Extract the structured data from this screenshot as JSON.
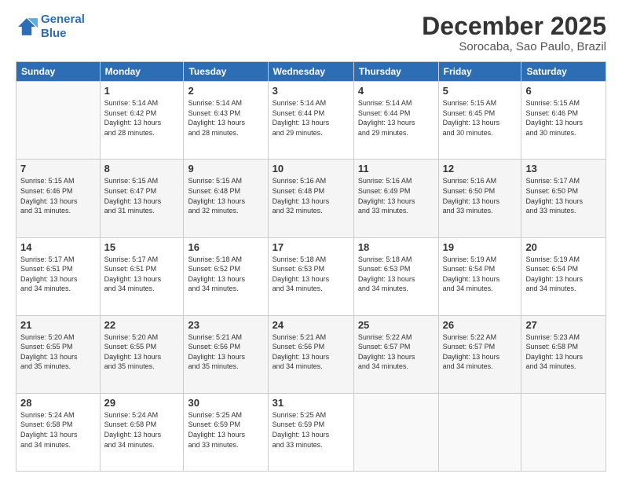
{
  "logo": {
    "line1": "General",
    "line2": "Blue"
  },
  "header": {
    "month": "December 2025",
    "location": "Sorocaba, Sao Paulo, Brazil"
  },
  "days_of_week": [
    "Sunday",
    "Monday",
    "Tuesday",
    "Wednesday",
    "Thursday",
    "Friday",
    "Saturday"
  ],
  "weeks": [
    [
      {
        "day": "",
        "info": ""
      },
      {
        "day": "1",
        "info": "Sunrise: 5:14 AM\nSunset: 6:42 PM\nDaylight: 13 hours\nand 28 minutes."
      },
      {
        "day": "2",
        "info": "Sunrise: 5:14 AM\nSunset: 6:43 PM\nDaylight: 13 hours\nand 28 minutes."
      },
      {
        "day": "3",
        "info": "Sunrise: 5:14 AM\nSunset: 6:44 PM\nDaylight: 13 hours\nand 29 minutes."
      },
      {
        "day": "4",
        "info": "Sunrise: 5:14 AM\nSunset: 6:44 PM\nDaylight: 13 hours\nand 29 minutes."
      },
      {
        "day": "5",
        "info": "Sunrise: 5:15 AM\nSunset: 6:45 PM\nDaylight: 13 hours\nand 30 minutes."
      },
      {
        "day": "6",
        "info": "Sunrise: 5:15 AM\nSunset: 6:46 PM\nDaylight: 13 hours\nand 30 minutes."
      }
    ],
    [
      {
        "day": "7",
        "info": "Sunrise: 5:15 AM\nSunset: 6:46 PM\nDaylight: 13 hours\nand 31 minutes."
      },
      {
        "day": "8",
        "info": "Sunrise: 5:15 AM\nSunset: 6:47 PM\nDaylight: 13 hours\nand 31 minutes."
      },
      {
        "day": "9",
        "info": "Sunrise: 5:15 AM\nSunset: 6:48 PM\nDaylight: 13 hours\nand 32 minutes."
      },
      {
        "day": "10",
        "info": "Sunrise: 5:16 AM\nSunset: 6:48 PM\nDaylight: 13 hours\nand 32 minutes."
      },
      {
        "day": "11",
        "info": "Sunrise: 5:16 AM\nSunset: 6:49 PM\nDaylight: 13 hours\nand 33 minutes."
      },
      {
        "day": "12",
        "info": "Sunrise: 5:16 AM\nSunset: 6:50 PM\nDaylight: 13 hours\nand 33 minutes."
      },
      {
        "day": "13",
        "info": "Sunrise: 5:17 AM\nSunset: 6:50 PM\nDaylight: 13 hours\nand 33 minutes."
      }
    ],
    [
      {
        "day": "14",
        "info": "Sunrise: 5:17 AM\nSunset: 6:51 PM\nDaylight: 13 hours\nand 34 minutes."
      },
      {
        "day": "15",
        "info": "Sunrise: 5:17 AM\nSunset: 6:51 PM\nDaylight: 13 hours\nand 34 minutes."
      },
      {
        "day": "16",
        "info": "Sunrise: 5:18 AM\nSunset: 6:52 PM\nDaylight: 13 hours\nand 34 minutes."
      },
      {
        "day": "17",
        "info": "Sunrise: 5:18 AM\nSunset: 6:53 PM\nDaylight: 13 hours\nand 34 minutes."
      },
      {
        "day": "18",
        "info": "Sunrise: 5:18 AM\nSunset: 6:53 PM\nDaylight: 13 hours\nand 34 minutes."
      },
      {
        "day": "19",
        "info": "Sunrise: 5:19 AM\nSunset: 6:54 PM\nDaylight: 13 hours\nand 34 minutes."
      },
      {
        "day": "20",
        "info": "Sunrise: 5:19 AM\nSunset: 6:54 PM\nDaylight: 13 hours\nand 34 minutes."
      }
    ],
    [
      {
        "day": "21",
        "info": "Sunrise: 5:20 AM\nSunset: 6:55 PM\nDaylight: 13 hours\nand 35 minutes."
      },
      {
        "day": "22",
        "info": "Sunrise: 5:20 AM\nSunset: 6:55 PM\nDaylight: 13 hours\nand 35 minutes."
      },
      {
        "day": "23",
        "info": "Sunrise: 5:21 AM\nSunset: 6:56 PM\nDaylight: 13 hours\nand 35 minutes."
      },
      {
        "day": "24",
        "info": "Sunrise: 5:21 AM\nSunset: 6:56 PM\nDaylight: 13 hours\nand 34 minutes."
      },
      {
        "day": "25",
        "info": "Sunrise: 5:22 AM\nSunset: 6:57 PM\nDaylight: 13 hours\nand 34 minutes."
      },
      {
        "day": "26",
        "info": "Sunrise: 5:22 AM\nSunset: 6:57 PM\nDaylight: 13 hours\nand 34 minutes."
      },
      {
        "day": "27",
        "info": "Sunrise: 5:23 AM\nSunset: 6:58 PM\nDaylight: 13 hours\nand 34 minutes."
      }
    ],
    [
      {
        "day": "28",
        "info": "Sunrise: 5:24 AM\nSunset: 6:58 PM\nDaylight: 13 hours\nand 34 minutes."
      },
      {
        "day": "29",
        "info": "Sunrise: 5:24 AM\nSunset: 6:58 PM\nDaylight: 13 hours\nand 34 minutes."
      },
      {
        "day": "30",
        "info": "Sunrise: 5:25 AM\nSunset: 6:59 PM\nDaylight: 13 hours\nand 33 minutes."
      },
      {
        "day": "31",
        "info": "Sunrise: 5:25 AM\nSunset: 6:59 PM\nDaylight: 13 hours\nand 33 minutes."
      },
      {
        "day": "",
        "info": ""
      },
      {
        "day": "",
        "info": ""
      },
      {
        "day": "",
        "info": ""
      }
    ]
  ]
}
